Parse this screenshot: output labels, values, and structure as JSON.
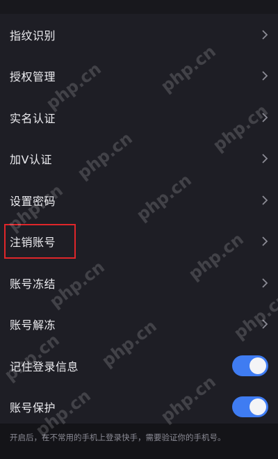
{
  "settings": {
    "items": [
      {
        "label": "指纹识别",
        "control": "chevron"
      },
      {
        "label": "授权管理",
        "control": "chevron"
      },
      {
        "label": "实名认证",
        "control": "chevron"
      },
      {
        "label": "加V认证",
        "control": "chevron"
      },
      {
        "label": "设置密码",
        "control": "chevron"
      },
      {
        "label": "注销账号",
        "control": "chevron",
        "highlighted": true
      },
      {
        "label": "账号冻结",
        "control": "chevron"
      },
      {
        "label": "账号解冻",
        "control": "chevron"
      },
      {
        "label": "记住登录信息",
        "control": "toggle",
        "on": true
      },
      {
        "label": "账号保护",
        "control": "toggle",
        "on": true
      }
    ]
  },
  "footer": {
    "note": "开启后，在不常用的手机上登录快手，需要验证你的手机号。"
  },
  "watermark": {
    "text": "php.cn"
  },
  "colors": {
    "background": "#1e1e25",
    "toggle_on": "#3f7cf2",
    "highlight_border": "#e0262a"
  }
}
